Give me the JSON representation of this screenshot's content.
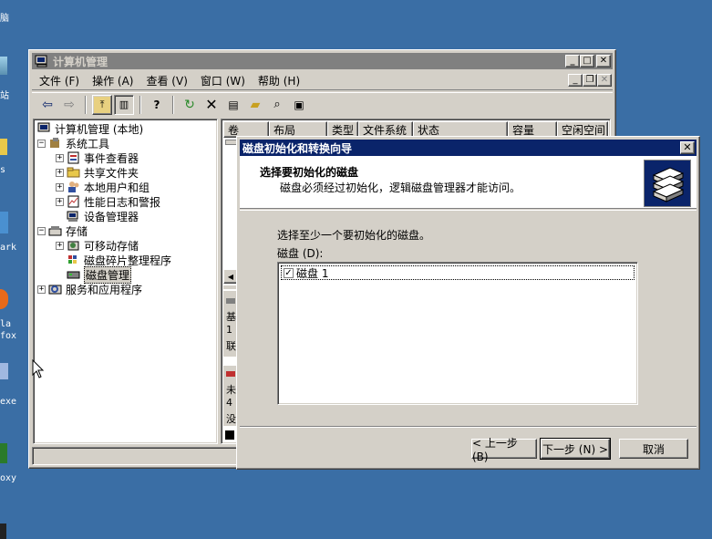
{
  "desktop": {
    "labels": [
      "脑",
      "站",
      "s",
      "ark",
      "la",
      "fox",
      "exe",
      "oxy"
    ]
  },
  "mmc": {
    "title": "计算机管理",
    "menu": [
      "文件 (F)",
      "操作 (A)",
      "查看 (V)",
      "窗口 (W)",
      "帮助 (H)"
    ],
    "tree": {
      "root": "计算机管理 (本地)",
      "system_tools": "系统工具",
      "event_viewer": "事件查看器",
      "shared_folders": "共享文件夹",
      "local_users": "本地用户和组",
      "perf_logs": "性能日志和警报",
      "device_manager": "设备管理器",
      "storage": "存储",
      "removable_storage": "可移动存储",
      "defrag": "磁盘碎片整理程序",
      "disk_mgmt": "磁盘管理",
      "services": "服务和应用程序"
    },
    "columns": [
      "卷",
      "布局",
      "类型",
      "文件系统",
      "状态",
      "容量",
      "空闲空间"
    ],
    "partial_text": {
      "a": "基",
      "b": "1",
      "c": "联",
      "d": "未",
      "e": "4",
      "f": "没"
    }
  },
  "dialog": {
    "title": "磁盘初始化和转换向导",
    "header_title": "选择要初始化的磁盘",
    "header_sub": "磁盘必须经过初始化，逻辑磁盘管理器才能访问。",
    "prompt": "选择至少一个要初始化的磁盘。",
    "list_label": "磁盘 (D):",
    "disks": [
      {
        "label": "磁盘 1",
        "checked": true
      }
    ],
    "back_button": "< 上一步 (B)",
    "next_button": "下一步 (N) >",
    "cancel_button": "取消",
    "check_mark": "✓"
  },
  "colors": {
    "desktop": "#3a6ea5",
    "active_title": "#0a246a",
    "inactive_title": "#808080",
    "face": "#d4d0c8"
  }
}
